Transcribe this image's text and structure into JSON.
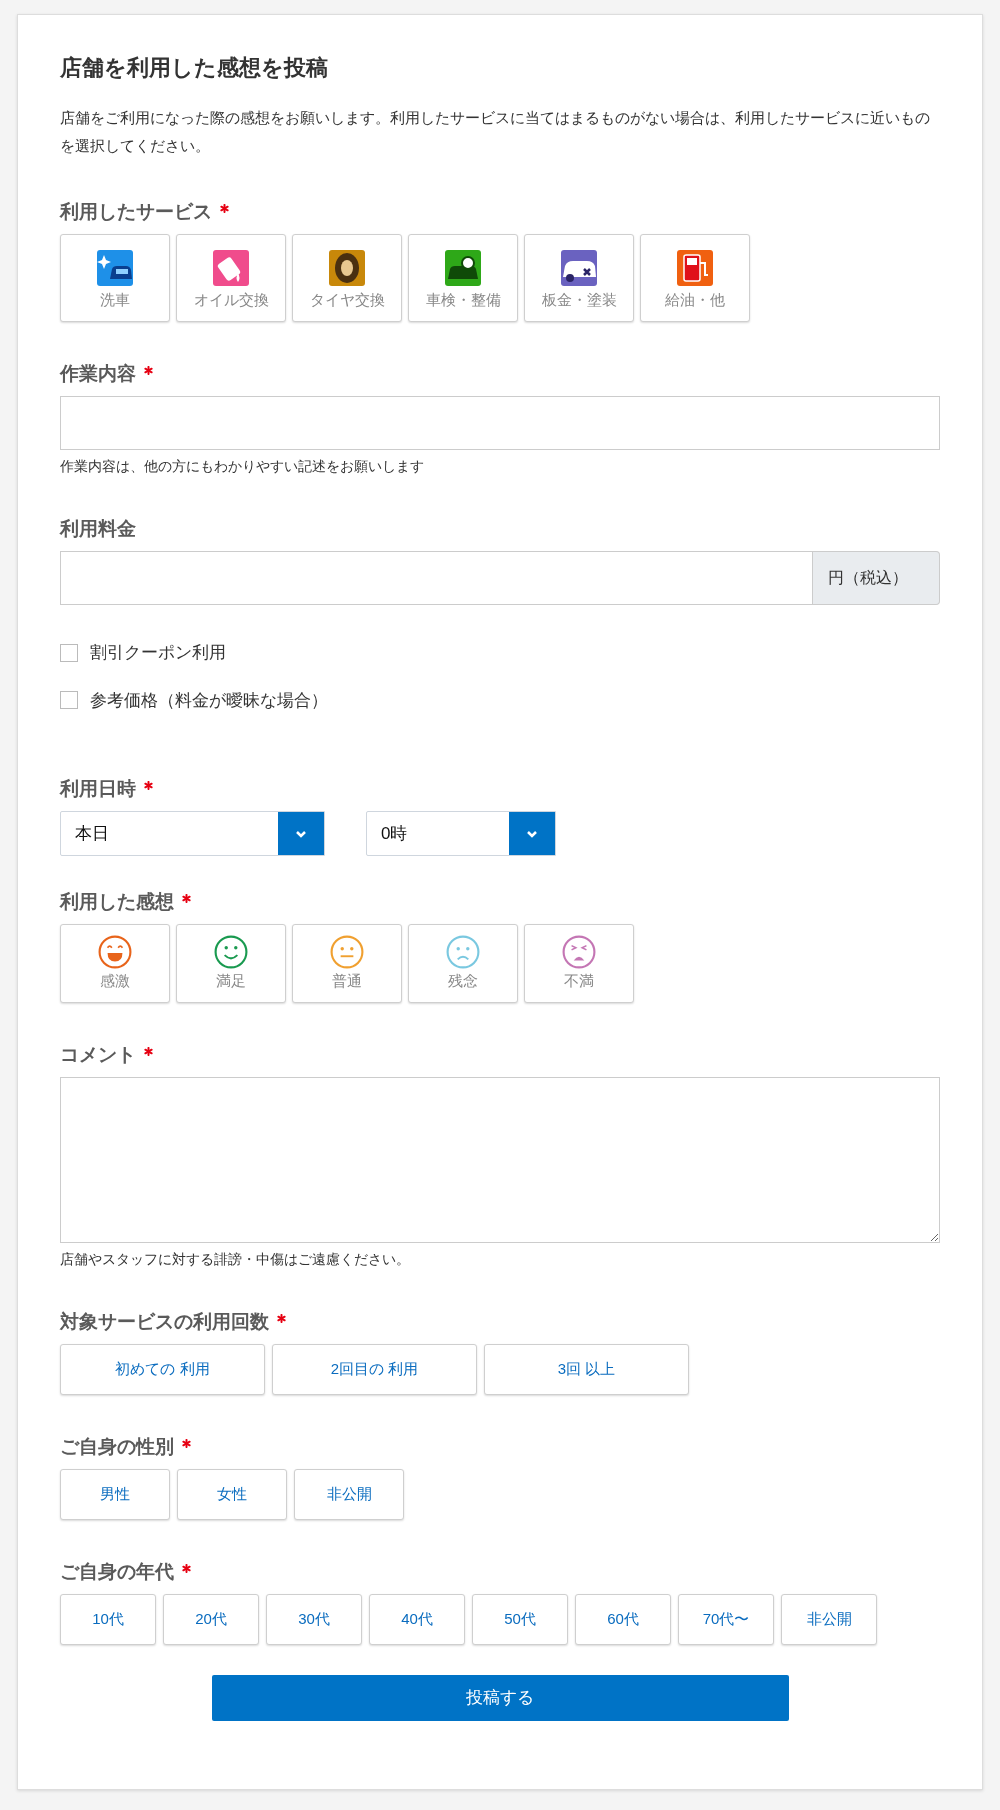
{
  "title": "店舗を利用した感想を投稿",
  "description": "店舗をご利用になった際の感想をお願いします。利用したサービスに当てはまるものがない場合は、利用したサービスに近いものを選択してください。",
  "fields": [
    {
      "kind": "service_tiles",
      "label": "利用したサービス",
      "required": true,
      "options": [
        {
          "label": "洗車",
          "selected": false
        },
        {
          "label": "オイル交換",
          "selected": false
        },
        {
          "label": "タイヤ交換",
          "selected": false
        },
        {
          "label": "車検・整備",
          "selected": false
        },
        {
          "label": "板金・塗装",
          "selected": false
        },
        {
          "label": "給油・他",
          "selected": false
        }
      ]
    },
    {
      "kind": "text",
      "label": "作業内容",
      "required": true,
      "hint": "作業内容は、他の方にもわかりやすい記述をお願いします"
    },
    {
      "kind": "price",
      "label": "利用料金",
      "required": false,
      "suffix": "円（税込）",
      "checkboxes": [
        {
          "label": "割引クーポン利用",
          "checked": false
        },
        {
          "label": "参考価格（料金が曖昧な場合）",
          "checked": false
        }
      ]
    },
    {
      "kind": "datetime",
      "label": "利用日時",
      "required": true,
      "selects": [
        {
          "value": "本日"
        },
        {
          "value": "0時"
        }
      ]
    },
    {
      "kind": "mood_tiles",
      "label": "利用した感想",
      "required": true,
      "options": [
        {
          "label": "感激",
          "selected": false,
          "color": "#e8641b"
        },
        {
          "label": "満足",
          "selected": false,
          "color": "#1a9a50"
        },
        {
          "label": "普通",
          "selected": false,
          "color": "#f0a030"
        },
        {
          "label": "残念",
          "selected": false,
          "color": "#7ac8e0"
        },
        {
          "label": "不満",
          "selected": false,
          "color": "#c476b4"
        }
      ]
    },
    {
      "kind": "textarea",
      "label": "コメント",
      "required": true,
      "hint": "店舗やスタッフに対する誹謗・中傷はご遠慮ください。"
    },
    {
      "kind": "buttons",
      "label": "対象サービスの利用回数",
      "required": true,
      "options": [
        {
          "label": "初めての 利用",
          "selected": false
        },
        {
          "label": "2回目の 利用",
          "selected": false
        },
        {
          "label": "3回 以上",
          "selected": false
        }
      ]
    },
    {
      "kind": "buttons",
      "label": "ご自身の性別",
      "required": true,
      "options": [
        {
          "label": "男性",
          "selected": false
        },
        {
          "label": "女性",
          "selected": false
        },
        {
          "label": "非公開",
          "selected": false
        }
      ]
    },
    {
      "kind": "buttons",
      "label": "ご自身の年代",
      "required": true,
      "options": [
        {
          "label": "10代",
          "selected": false
        },
        {
          "label": "20代",
          "selected": false
        },
        {
          "label": "30代",
          "selected": false
        },
        {
          "label": "40代",
          "selected": false
        },
        {
          "label": "50代",
          "selected": false
        },
        {
          "label": "60代",
          "selected": false
        },
        {
          "label": "70代〜",
          "selected": false
        },
        {
          "label": "非公開",
          "selected": false
        }
      ]
    }
  ],
  "submit": "投稿する"
}
